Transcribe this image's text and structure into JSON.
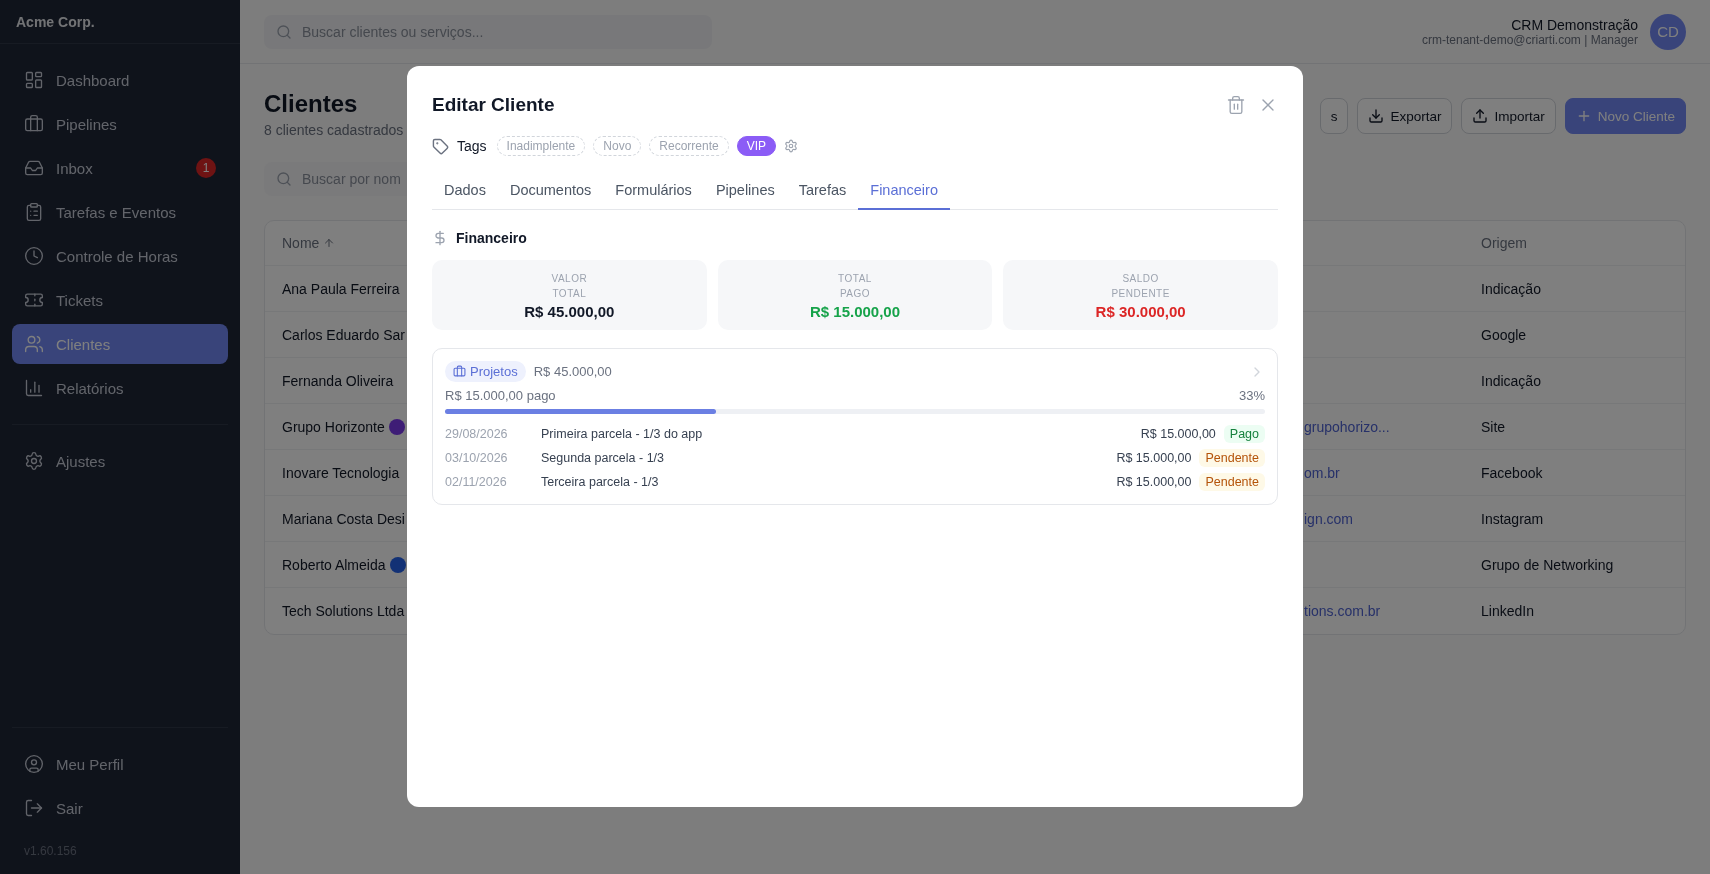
{
  "sidebar": {
    "brand": "Acme Corp.",
    "items": [
      {
        "label": "Dashboard",
        "selected": false
      },
      {
        "label": "Pipelines",
        "selected": false
      },
      {
        "label": "Inbox",
        "selected": false,
        "badge": "1"
      },
      {
        "label": "Tarefas e Eventos",
        "selected": false
      },
      {
        "label": "Controle de Horas",
        "selected": false
      },
      {
        "label": "Tickets",
        "selected": false
      },
      {
        "label": "Clientes",
        "selected": true
      },
      {
        "label": "Relatórios",
        "selected": false
      }
    ],
    "settings": [
      {
        "label": "Ajustes",
        "selected": false
      }
    ],
    "footer": [
      {
        "label": "Meu Perfil"
      },
      {
        "label": "Sair"
      }
    ],
    "version": "v1.60.156"
  },
  "header": {
    "search_placeholder": "Buscar clientes ou serviços...",
    "user_name": "CRM Demonstração",
    "user_detail": "crm-tenant-demo@criarti.com | Manager",
    "avatar": "CD"
  },
  "page": {
    "title": "Clientes",
    "subtitle": "8 clientes cadastrados",
    "actions": [
      {
        "label": "s",
        "kind": "outline"
      },
      {
        "label": "Exportar",
        "kind": "export"
      },
      {
        "label": "Importar",
        "kind": "import"
      },
      {
        "label": "Novo Cliente",
        "kind": "primary"
      }
    ],
    "filter_placeholder": "Buscar por nom"
  },
  "table": {
    "columns": [
      "Nome",
      "Origem"
    ],
    "rows": [
      {
        "name": "Ana Paula Ferreira",
        "origin": "Indicação"
      },
      {
        "name": "Carlos Eduardo Sar",
        "origin": "Google"
      },
      {
        "name": "Fernanda Oliveira",
        "origin": "Indicação"
      },
      {
        "name": "Grupo Horizonte",
        "badge": {
          "color": "#3e1d76"
        },
        "email": "grupohorizo...",
        "origin": "Site"
      },
      {
        "name": "Inovare Tecnologia",
        "email": "om.br",
        "origin": "Facebook"
      },
      {
        "name": "Mariana Costa Desi",
        "email": "ign.com",
        "origin": "Instagram"
      },
      {
        "name": "Roberto Almeida",
        "badge": {
          "color": "#123175"
        },
        "origin": "Grupo de Networking"
      },
      {
        "name": "Tech Solutions Ltda",
        "email": "tions.com.br",
        "origin": "LinkedIn"
      }
    ]
  },
  "modal": {
    "title": "Editar Cliente",
    "tags_label": "Tags",
    "tags": [
      {
        "label": "Inadimplente",
        "selected": false
      },
      {
        "label": "Novo",
        "selected": false
      },
      {
        "label": "Recorrente",
        "selected": false
      },
      {
        "label": "VIP",
        "selected": true
      }
    ],
    "tabs": [
      {
        "label": "Dados",
        "selected": false
      },
      {
        "label": "Documentos",
        "selected": false
      },
      {
        "label": "Formulários",
        "selected": false
      },
      {
        "label": "Pipelines",
        "selected": false
      },
      {
        "label": "Tarefas",
        "selected": false
      },
      {
        "label": "Financeiro",
        "selected": true
      }
    ],
    "section_title": "Financeiro",
    "summary": [
      {
        "label1": "VALOR",
        "label2": "TOTAL",
        "value": "R$ 45.000,00",
        "kind": "total"
      },
      {
        "label1": "TOTAL",
        "label2": "PAGO",
        "value": "R$ 15.000,00",
        "kind": "paid"
      },
      {
        "label1": "SALDO",
        "label2": "PENDENTE",
        "value": "R$ 30.000,00",
        "kind": "pending"
      }
    ],
    "project": {
      "category": "Projetos",
      "amount": "R$ 45.000,00",
      "paid_text": "R$ 15.000,00 pago",
      "percent": "33%",
      "level": 0.33,
      "installments": [
        {
          "date": "29/08/2026",
          "description": "Primeira parcela - 1/3 do app",
          "amount": "R$ 15.000,00",
          "status": "Pago",
          "kind": "paid"
        },
        {
          "date": "03/10/2026",
          "description": "Segunda parcela - 1/3",
          "amount": "R$ 15.000,00",
          "status": "Pendente",
          "kind": "pending"
        },
        {
          "date": "02/11/2026",
          "description": "Terceira parcela - 1/3",
          "amount": "R$ 15.000,00",
          "status": "Pendente",
          "kind": "pending"
        }
      ]
    }
  }
}
